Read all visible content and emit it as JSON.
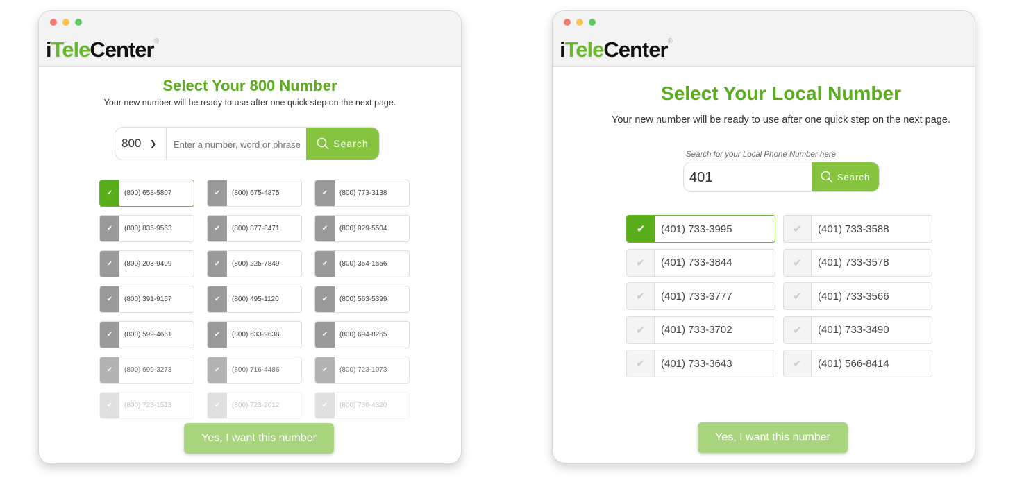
{
  "brand": {
    "logo_text_pre": "i",
    "logo_text_green": "Tele",
    "logo_text_post": "Center",
    "accent": "#6ab82d"
  },
  "toll_free": {
    "title": "Select Your 800 Number",
    "subtitle": "Your new number will be ready to use after one quick step on the next page.",
    "prefix_select": "800",
    "search_placeholder": "Enter a number, word or phrase",
    "search_label": "Search",
    "selected_index": 0,
    "numbers": [
      "(800) 658-5807",
      "(800) 675-4875",
      "(800) 773-3138",
      "(800) 835-9563",
      "(800) 877-8471",
      "(800) 929-5504",
      "(800) 203-9409",
      "(800) 225-7849",
      "(800) 354-1556",
      "(800) 391-9157",
      "(800) 495-1120",
      "(800) 563-5399",
      "(800) 599-4661",
      "(800) 633-9638",
      "(800) 694-8265",
      "(800) 699-3273",
      "(800) 716-4486",
      "(800) 723-1073",
      "(800) 723-1513",
      "(800) 723-2012",
      "(800) 730-4320"
    ],
    "confirm_label": "Yes, I want this number"
  },
  "local": {
    "title": "Select Your Local Number",
    "subtitle": "Your new number will be ready to use after one quick step on the next page.",
    "search_hint": "Search for your Local Phone Number here",
    "search_value": "401",
    "search_label": "Search",
    "selected_index": 0,
    "numbers": [
      "(401) 733-3995",
      "(401) 733-3588",
      "(401) 733-3844",
      "(401) 733-3578",
      "(401) 733-3777",
      "(401) 733-3566",
      "(401) 733-3702",
      "(401) 733-3490",
      "(401) 733-3643",
      "(401) 566-8414"
    ],
    "confirm_label": "Yes, I want this number"
  }
}
